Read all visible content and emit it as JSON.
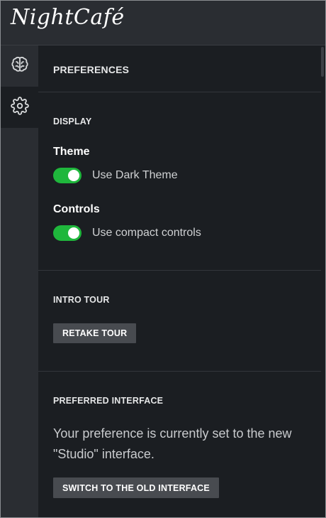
{
  "app": {
    "logo_text": "NightCafé"
  },
  "rail": [
    {
      "icon": "brain-icon",
      "active": false
    },
    {
      "icon": "gear-icon",
      "active": true
    }
  ],
  "panel": {
    "title": "PREFERENCES",
    "display": {
      "heading": "DISPLAY",
      "theme": {
        "label": "Theme",
        "toggle_text": "Use Dark Theme",
        "on": true
      },
      "controls": {
        "label": "Controls",
        "toggle_text": "Use compact controls",
        "on": true
      }
    },
    "intro_tour": {
      "heading": "INTRO TOUR",
      "button": "RETAKE TOUR"
    },
    "preferred_interface": {
      "heading": "PREFERRED INTERFACE",
      "text": "Your preference is currently set to the new \"Studio\" interface.",
      "button": "SWITCH TO THE OLD INTERFACE"
    }
  },
  "colors": {
    "accent_green": "#1fb73c",
    "background": "#1b1e22",
    "sidebar": "#2a2d32",
    "button": "#484b50"
  }
}
